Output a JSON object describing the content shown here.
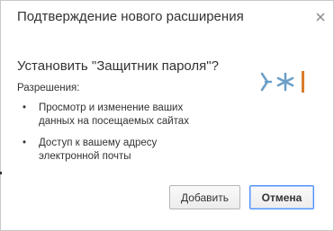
{
  "dialog": {
    "title": "Подтверждение нового расширения",
    "question": "Установить \"Защитник пароля\"?",
    "permissions_heading": "Разрешения:",
    "permissions": [
      "Просмотр и изменение ваших данных на посещаемых сайтах",
      "Доступ к вашему адресу электронной почты"
    ],
    "bullet": "•",
    "buttons": {
      "add_label": "Добавить",
      "cancel_label": "Отмена"
    },
    "icons": {
      "close": "close-icon",
      "extension": "extension-icon"
    },
    "colors": {
      "cancel_border": "#4d90fe",
      "icon_blue": "#6a9fc8",
      "icon_orange": "#d97d2a"
    }
  }
}
